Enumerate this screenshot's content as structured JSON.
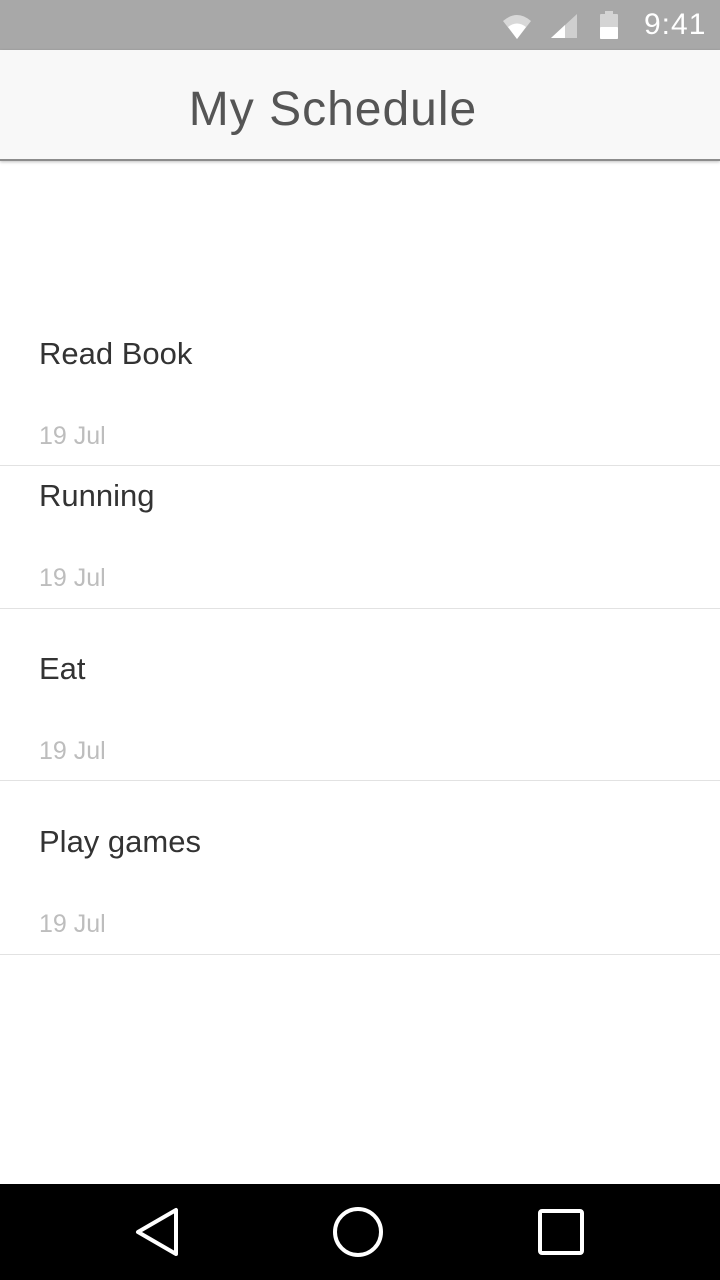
{
  "status_bar": {
    "time": "9:41",
    "icons": [
      "wifi-icon",
      "cellular-signal-icon",
      "battery-icon"
    ]
  },
  "app_bar": {
    "title": "My Schedule"
  },
  "schedule": {
    "items": [
      {
        "title": "Read Book",
        "date": "19 Jul"
      },
      {
        "title": "Running",
        "date": "19 Jul"
      },
      {
        "title": "Eat",
        "date": "19 Jul"
      },
      {
        "title": "Play games",
        "date": "19 Jul"
      }
    ]
  },
  "nav_bar": {
    "icons": [
      "back-icon",
      "home-icon",
      "recents-icon"
    ]
  },
  "colors": {
    "status_bar": "#a8a8a8",
    "app_bar": "#f8f8f8",
    "title_text": "#555555",
    "item_title": "#333333",
    "item_date": "#bdbdbd",
    "divider": "#e2e2e2",
    "nav_bar": "#000000"
  }
}
